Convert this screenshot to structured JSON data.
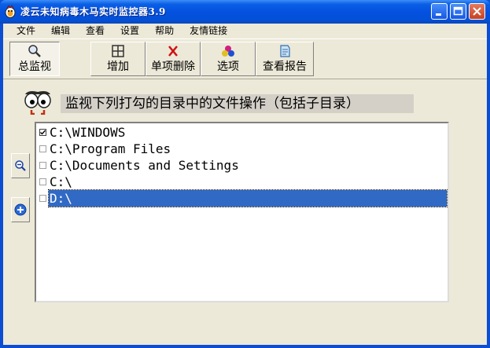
{
  "window": {
    "title": "凌云未知病毒木马实时监控器3.9"
  },
  "menu": [
    "文件",
    "编辑",
    "查看",
    "设置",
    "帮助",
    "友情链接"
  ],
  "toolbar": {
    "overview": "总监视",
    "add": "增加",
    "delete_item": "单项删除",
    "options": "选项",
    "view_report": "查看报告"
  },
  "heading": "监视下列打勾的目录中的文件操作（包括子目录）",
  "directories": [
    {
      "path": "C:\\WINDOWS",
      "checked": true,
      "selected": false
    },
    {
      "path": "C:\\Program Files",
      "checked": false,
      "selected": false
    },
    {
      "path": "C:\\Documents and Settings",
      "checked": false,
      "selected": false
    },
    {
      "path": "C:\\",
      "checked": false,
      "selected": false
    },
    {
      "path": "D:\\",
      "checked": false,
      "selected": true
    }
  ],
  "colors": {
    "titlebar": "#0451df",
    "selection": "#316ac5",
    "face": "#ece9d8"
  }
}
